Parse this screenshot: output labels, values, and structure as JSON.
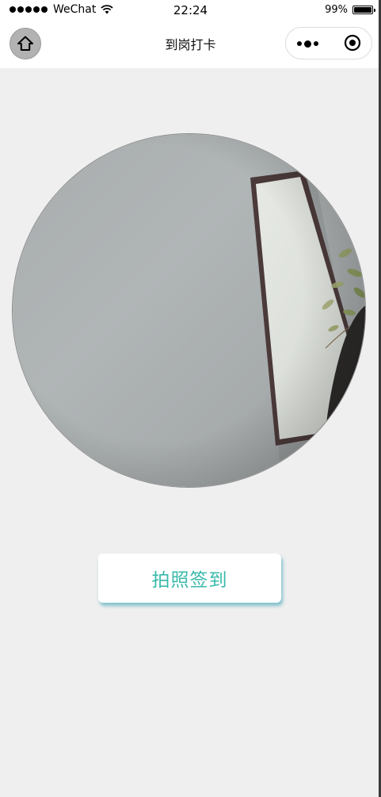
{
  "status_bar": {
    "carrier": "WeChat",
    "time": "22:24",
    "battery_text": "99%",
    "battery_level": 0.99,
    "signal_icon": "signal-dots-icon",
    "wifi_icon": "wifi-icon"
  },
  "nav": {
    "title": "到岗打卡",
    "home_icon": "home-icon",
    "more_icon": "more-dots-icon",
    "close_icon": "target-close-icon"
  },
  "camera": {
    "description_icon": "camera-preview"
  },
  "actions": {
    "sign_button_label": "拍照签到"
  },
  "colors": {
    "page_background": "#efefef",
    "accent_text": "#3ab9aa",
    "button_shadow": "#5fb2c0"
  }
}
